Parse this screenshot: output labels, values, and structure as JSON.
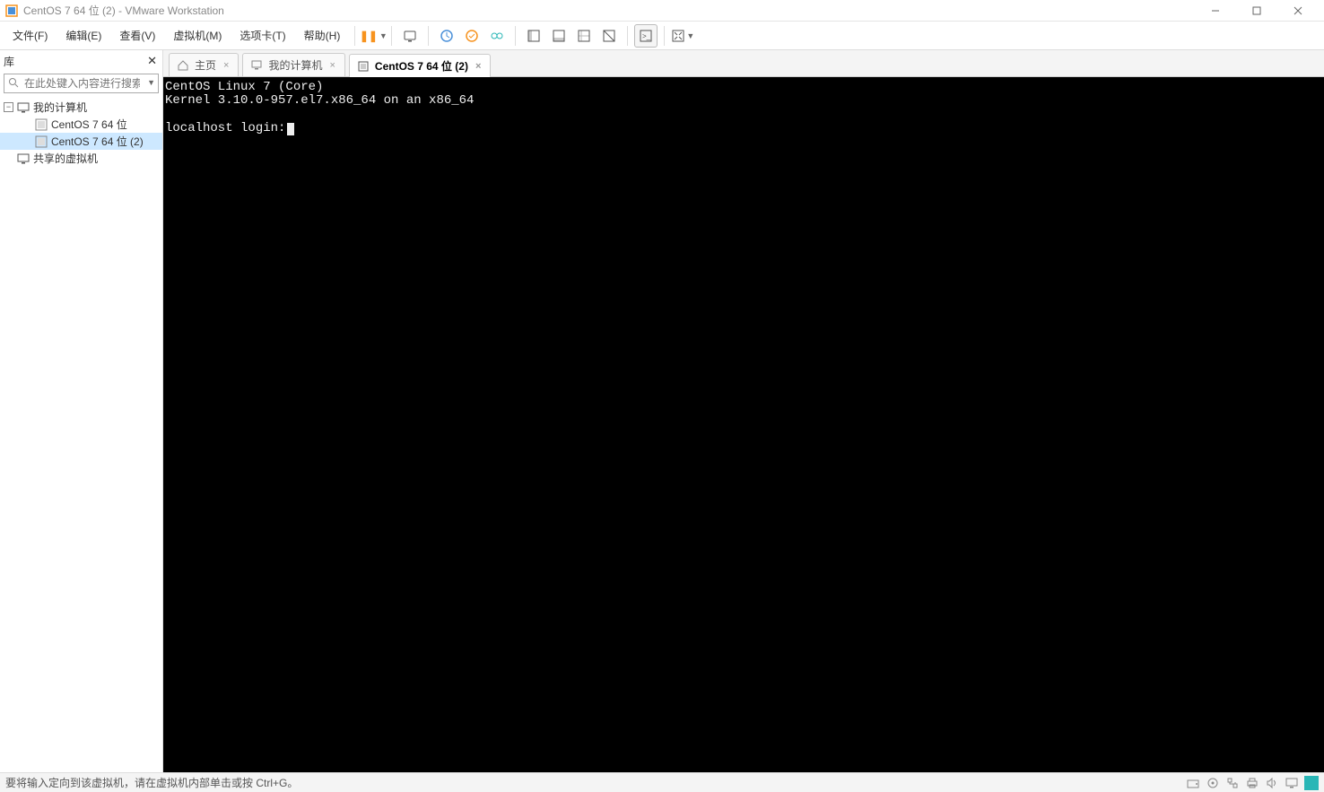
{
  "window": {
    "title": "CentOS 7 64 位 (2) - VMware Workstation"
  },
  "menus": [
    "文件(F)",
    "编辑(E)",
    "查看(V)",
    "虚拟机(M)",
    "选项卡(T)",
    "帮助(H)"
  ],
  "sidebar": {
    "header": "库",
    "search_placeholder": "在此处键入内容进行搜索",
    "tree": {
      "root_label": "我的计算机",
      "items": [
        "CentOS 7 64 位",
        "CentOS 7 64 位 (2)"
      ],
      "shared_label": "共享的虚拟机"
    }
  },
  "tabs": [
    {
      "label": "主页",
      "active": false
    },
    {
      "label": "我的计算机",
      "active": false
    },
    {
      "label": "CentOS 7 64 位 (2)",
      "active": true
    }
  ],
  "console": {
    "line1": "CentOS Linux 7 (Core)",
    "line2": "Kernel 3.10.0-957.el7.x86_64 on an x86_64",
    "line3": "",
    "line4": "localhost login:"
  },
  "statusbar": {
    "text": "要将输入定向到该虚拟机，请在虚拟机内部单击或按 Ctrl+G。"
  }
}
